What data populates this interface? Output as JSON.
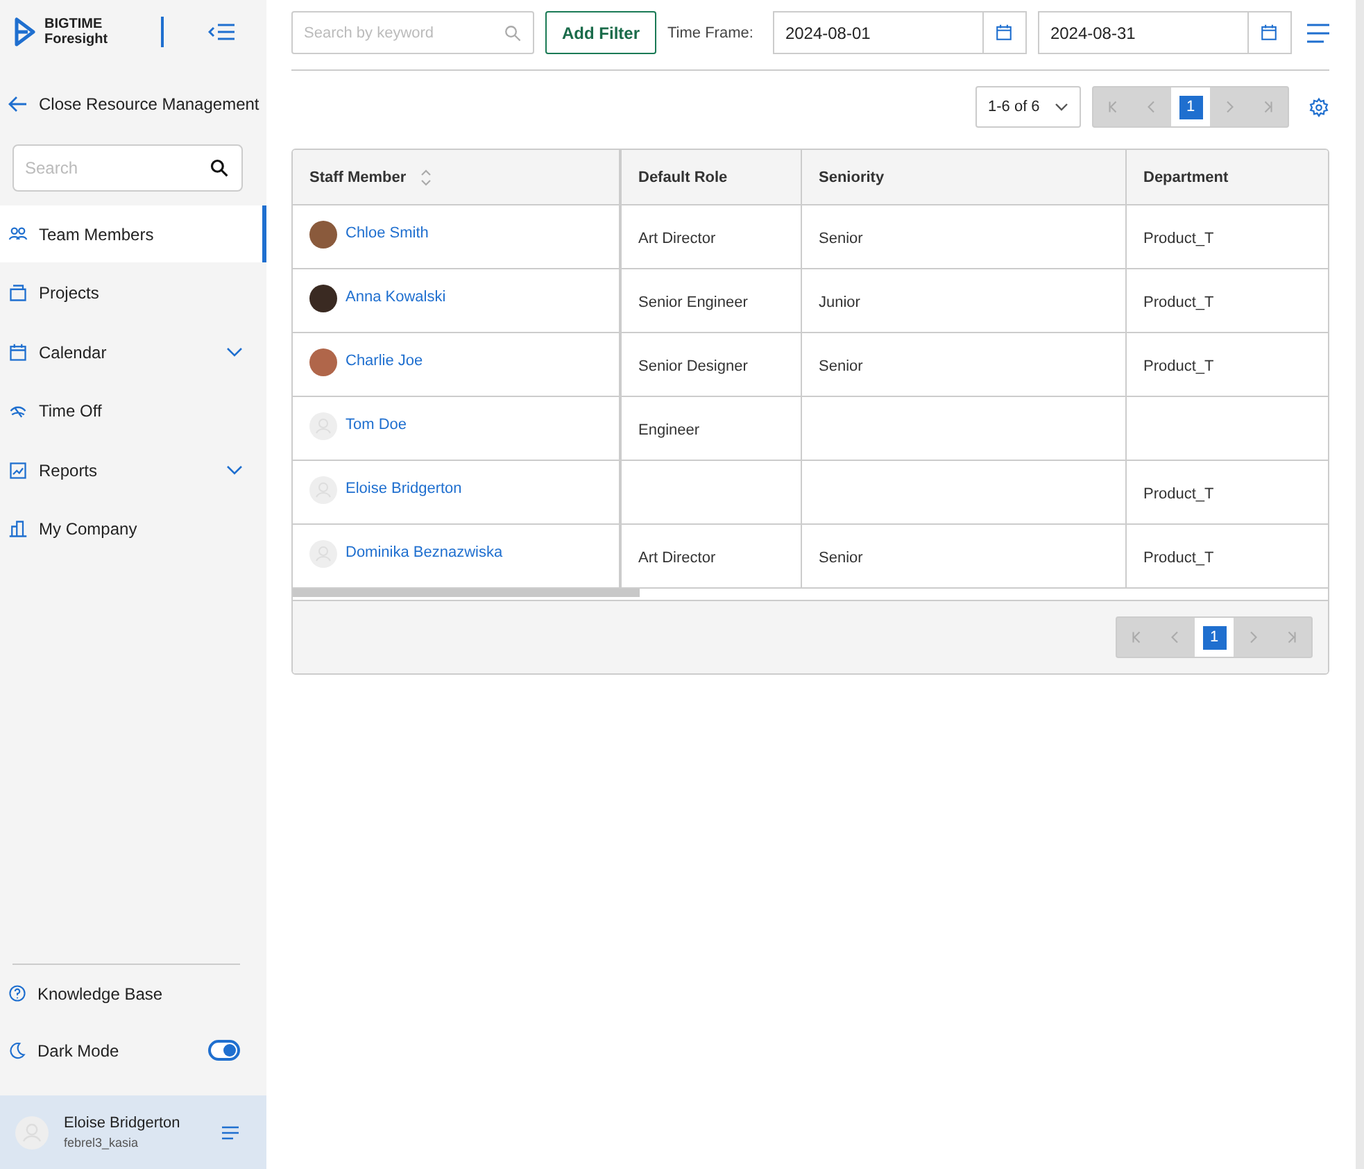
{
  "sidebar": {
    "brand": {
      "line1": "BIGTIME",
      "line2": "Foresight"
    },
    "back_link": "Close Resource Management",
    "search": {
      "placeholder": "Search"
    },
    "items": [
      {
        "label": "Team Members",
        "kind": "people",
        "selected": true,
        "expandable": false
      },
      {
        "label": "Projects",
        "kind": "folder",
        "selected": false,
        "expandable": false
      },
      {
        "label": "Calendar",
        "kind": "calendar",
        "selected": false,
        "expandable": true
      },
      {
        "label": "Time Off",
        "kind": "plane",
        "selected": false,
        "expandable": false
      },
      {
        "label": "Reports",
        "kind": "chart",
        "selected": false,
        "expandable": true
      },
      {
        "label": "My Company",
        "kind": "building",
        "selected": false,
        "expandable": false
      }
    ],
    "bottom": {
      "knowledge_base": "Knowledge Base",
      "dark_mode": {
        "label": "Dark Mode",
        "on": true
      }
    },
    "user": {
      "name": "Eloise Bridgerton",
      "username": "febrel3_kasia"
    }
  },
  "toolbar": {
    "search": {
      "placeholder": "Search by keyword"
    },
    "add_filter": "Add Filter",
    "time_frame_label": "Time Frame:",
    "start_date": "2024-08-01",
    "end_date": "2024-08-31"
  },
  "pagination_top": {
    "range": "1-6 of 6",
    "page": "1"
  },
  "table": {
    "columns": [
      {
        "label": "Staff Member",
        "sortable": true
      },
      {
        "label": "Default Role",
        "sortable": false
      },
      {
        "label": "Seniority",
        "sortable": false
      },
      {
        "label": "Department",
        "sortable": false
      }
    ],
    "rows": [
      {
        "name": "Chloe Smith",
        "kind": "photo",
        "color": "#8a5a3c",
        "role": "Art Director",
        "seniority": "Senior",
        "department": "Product_T"
      },
      {
        "name": "Anna Kowalski",
        "kind": "photo",
        "color": "#3a2a22",
        "role": "Senior Engineer",
        "seniority": "Junior",
        "department": "Product_T"
      },
      {
        "name": "Charlie Joe",
        "kind": "photo",
        "color": "#b0664a",
        "role": "Senior Designer",
        "seniority": "Senior",
        "department": "Product_T"
      },
      {
        "name": "Tom Doe",
        "kind": "placeholder",
        "role": "Engineer"
      },
      {
        "name": "Eloise Bridgerton",
        "kind": "placeholder",
        "department": "Product_T"
      },
      {
        "name": "Dominika Beznazwiska",
        "kind": "placeholder",
        "role": "Art Director",
        "seniority": "Senior",
        "department": "Product_T"
      }
    ]
  },
  "pagination_bottom": {
    "page": "1"
  }
}
